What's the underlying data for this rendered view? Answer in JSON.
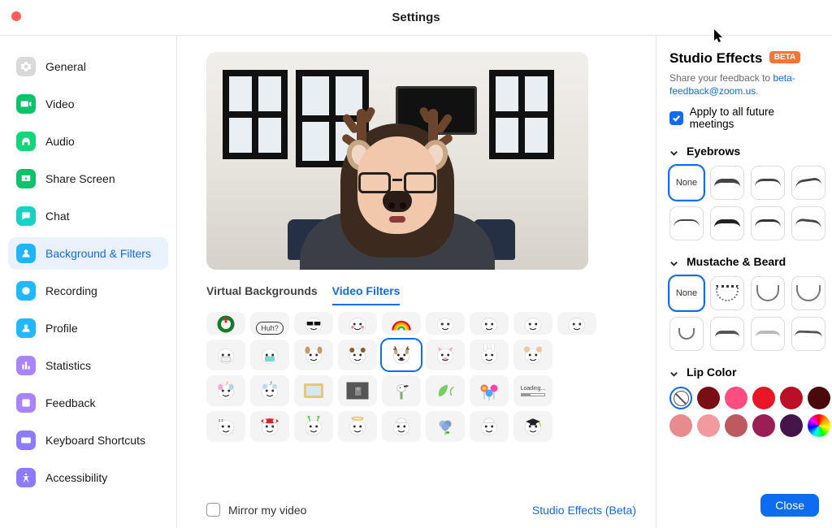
{
  "window": {
    "title": "Settings"
  },
  "sidebar": {
    "items": [
      {
        "label": "General",
        "name": "sidebar-item-general",
        "icon": "gear-icon",
        "color": "ic-grey"
      },
      {
        "label": "Video",
        "name": "sidebar-item-video",
        "icon": "video-icon",
        "color": "ic-green"
      },
      {
        "label": "Audio",
        "name": "sidebar-item-audio",
        "icon": "headphones-icon",
        "color": "ic-greenL"
      },
      {
        "label": "Share Screen",
        "name": "sidebar-item-share",
        "icon": "share-icon",
        "color": "ic-green"
      },
      {
        "label": "Chat",
        "name": "sidebar-item-chat",
        "icon": "chat-icon",
        "color": "ic-teal"
      },
      {
        "label": "Background & Filters",
        "name": "sidebar-item-bg",
        "icon": "bg-icon",
        "color": "ic-blue",
        "active": true
      },
      {
        "label": "Recording",
        "name": "sidebar-item-recording",
        "icon": "record-icon",
        "color": "ic-blue2"
      },
      {
        "label": "Profile",
        "name": "sidebar-item-profile",
        "icon": "profile-icon",
        "color": "ic-blue2"
      },
      {
        "label": "Statistics",
        "name": "sidebar-item-stats",
        "icon": "stats-icon",
        "color": "ic-purple"
      },
      {
        "label": "Feedback",
        "name": "sidebar-item-feedback",
        "icon": "feedback-icon",
        "color": "ic-purple"
      },
      {
        "label": "Keyboard Shortcuts",
        "name": "sidebar-item-keys",
        "icon": "keyboard-icon",
        "color": "ic-purple2"
      },
      {
        "label": "Accessibility",
        "name": "sidebar-item-a11y",
        "icon": "a11y-icon",
        "color": "ic-purple2"
      }
    ]
  },
  "subtabs": {
    "virtual_bg": "Virtual Backgrounds",
    "video_filters": "Video Filters"
  },
  "filters": [
    {
      "row": 0,
      "items": [
        "wreath",
        "huh-speech",
        "pixel-glasses",
        "blush-face",
        "rainbow",
        "blink-face",
        "smile-face",
        "look-face",
        "stare-face"
      ]
    },
    {
      "row": 1,
      "items": [
        "mask-face",
        "surgical-mask",
        "dog-ears",
        "bear-ears",
        "reindeer",
        "pig-ears",
        "bunny-ears",
        "mouse-ears",
        ""
      ],
      "selected": 4
    },
    {
      "row": 2,
      "items": [
        "unicorn",
        "unicorn-blue",
        "photo-frame",
        "gray-frame",
        "bird",
        "leaf",
        "lollipops",
        "loading",
        ""
      ]
    },
    {
      "row": 3,
      "items": [
        "sleepy",
        "headband",
        "alien",
        "halo",
        "chef-smile",
        "hydrangea",
        "chef-hat",
        "grad-cap",
        ""
      ]
    }
  ],
  "huh_label": "Huh?",
  "loading_label": "Loading...",
  "footer": {
    "mirror_label": "Mirror my video",
    "studio_link": "Studio Effects (Beta)"
  },
  "studio": {
    "title": "Studio Effects",
    "beta": "BETA",
    "feedback_pre": "Share your feedback to ",
    "feedback_link": "beta-feedback@zoom.us",
    "feedback_post": ".",
    "apply_label": "Apply to all future meetings",
    "sections": {
      "eyebrows": "Eyebrows",
      "beard": "Mustache & Beard",
      "lip": "Lip Color"
    },
    "none_label": "None",
    "lip_colors": [
      "none",
      "#7a0e15",
      "#ff4d84",
      "#e81728",
      "#b91028",
      "#4a0a0d",
      "#e88b8f",
      "#f29a9d",
      "#bd5a60",
      "#991f55",
      "#45154a",
      "rainbow"
    ],
    "close": "Close"
  }
}
